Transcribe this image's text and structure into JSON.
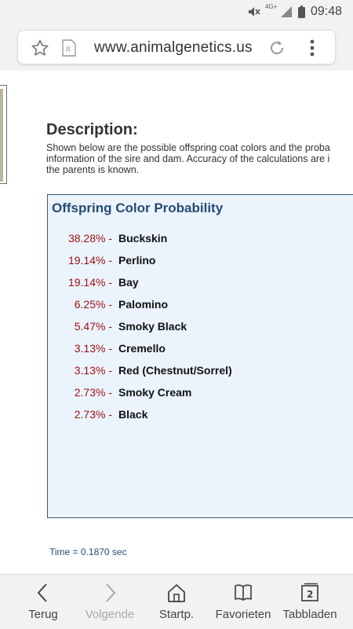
{
  "status_bar": {
    "time": "09:48",
    "network": "4G+",
    "icons": [
      "mute-icon",
      "signal-icon",
      "battery-icon"
    ]
  },
  "browser": {
    "url": "www.animalgenetics.us",
    "icons": [
      "star-icon",
      "reader-icon",
      "reload-icon",
      "more-icon"
    ]
  },
  "page": {
    "description_heading": "Description:",
    "description_lines": [
      "Shown below are the possible offspring coat colors and the proba",
      "information of the sire and dam. Accuracy of the calculations are i",
      "the parents is known."
    ],
    "probability_title": "Offspring Color Probability",
    "probabilities": [
      {
        "percent": "38.28% -",
        "color": "Buckskin"
      },
      {
        "percent": "19.14% -",
        "color": "Perlino"
      },
      {
        "percent": "19.14% -",
        "color": "Bay"
      },
      {
        "percent": "6.25% -",
        "color": "Palomino"
      },
      {
        "percent": "5.47% -",
        "color": "Smoky Black"
      },
      {
        "percent": "3.13% -",
        "color": "Cremello"
      },
      {
        "percent": "3.13% -",
        "color": "Red (Chestnut/Sorrel)"
      },
      {
        "percent": "2.73% -",
        "color": "Smoky Cream"
      },
      {
        "percent": "2.73% -",
        "color": "Black"
      }
    ],
    "timing": "Time = 0.1870 sec",
    "colors": {
      "percent": "#9e1010",
      "title": "#244c74",
      "box_bg": "#ebf3fd"
    }
  },
  "bottom_nav": {
    "back": "Terug",
    "forward": "Volgende",
    "home": "Startp.",
    "bookmarks": "Favorieten",
    "tabs": "Tabbladen",
    "tab_count": "2"
  }
}
